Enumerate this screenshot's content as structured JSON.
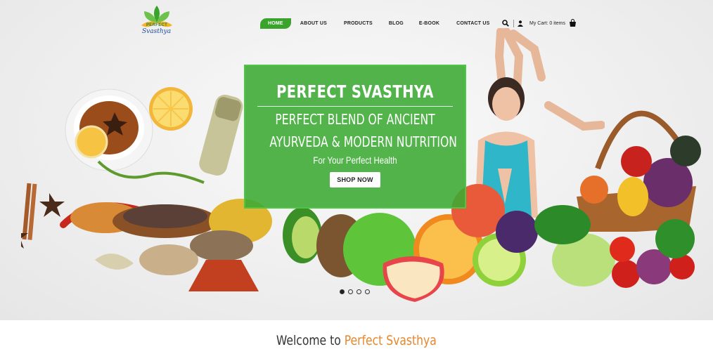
{
  "brand": {
    "logo_top": "PERFECT",
    "logo_bottom": "Svasthya"
  },
  "nav": {
    "home": "HOME",
    "about": "ABOUT US",
    "products": "PRODUCTS",
    "blog": "BLOG",
    "ebook": "E-BOOK",
    "contact": "CONTACT US"
  },
  "header": {
    "cart_label": "My Cart: 0 items"
  },
  "icons": [
    "leaf-logo-icon",
    "search-icon",
    "user-icon",
    "shopping-bag-icon"
  ],
  "colors": {
    "accent_green": "#3aa32b",
    "banner_green": "#3aaa32",
    "brand_orange": "#e8862a"
  },
  "banner": {
    "title": "PERFECT SVASTHYA",
    "line1": "PERFECT BLEND OF ANCIENT",
    "line2": "AYURVEDA & MODERN NUTRITION",
    "tagline": "For Your Perfect Health",
    "cta": "SHOP NOW"
  },
  "slider": {
    "slide_count": 4,
    "active_index": 0
  },
  "welcome": {
    "prefix": "Welcome to ",
    "brand": "Perfect Svasthya"
  }
}
